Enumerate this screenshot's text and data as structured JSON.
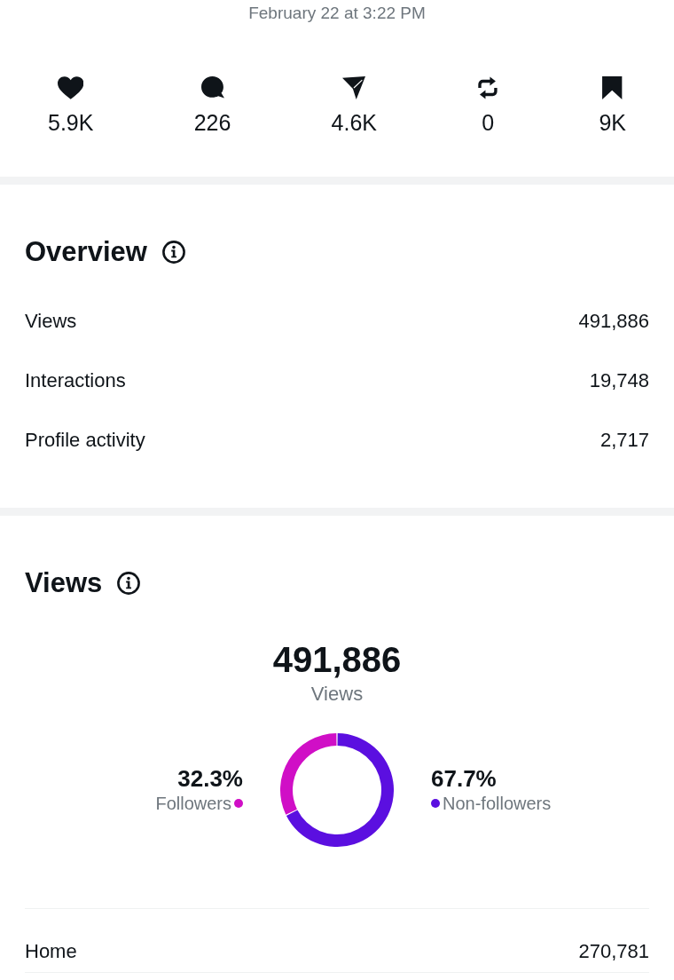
{
  "post_meta": {
    "timestamp": "February 22 at 3:22 PM"
  },
  "engagement": [
    {
      "kind": "like",
      "count": "5.9K"
    },
    {
      "kind": "reply",
      "count": "226"
    },
    {
      "kind": "share",
      "count": "4.6K"
    },
    {
      "kind": "repost",
      "count": "0"
    },
    {
      "kind": "bookmark",
      "count": "9K"
    }
  ],
  "overview": {
    "title": "Overview",
    "metrics": [
      {
        "label": "Views",
        "value": "491,886"
      },
      {
        "label": "Interactions",
        "value": "19,748"
      },
      {
        "label": "Profile activity",
        "value": "2,717"
      }
    ]
  },
  "views": {
    "title": "Views",
    "total": "491,886",
    "total_label": "Views",
    "chart_data": {
      "type": "donut",
      "categories": [
        "Followers",
        "Non-followers"
      ],
      "values": [
        32.3,
        67.7
      ]
    },
    "legend": [
      {
        "percent": "32.3%",
        "color": "#d00fc6"
      },
      {
        "percent": "67.7%",
        "color": "#5b0fe0"
      }
    ],
    "sources": [
      {
        "label": "Home",
        "value": "270,781"
      }
    ]
  }
}
